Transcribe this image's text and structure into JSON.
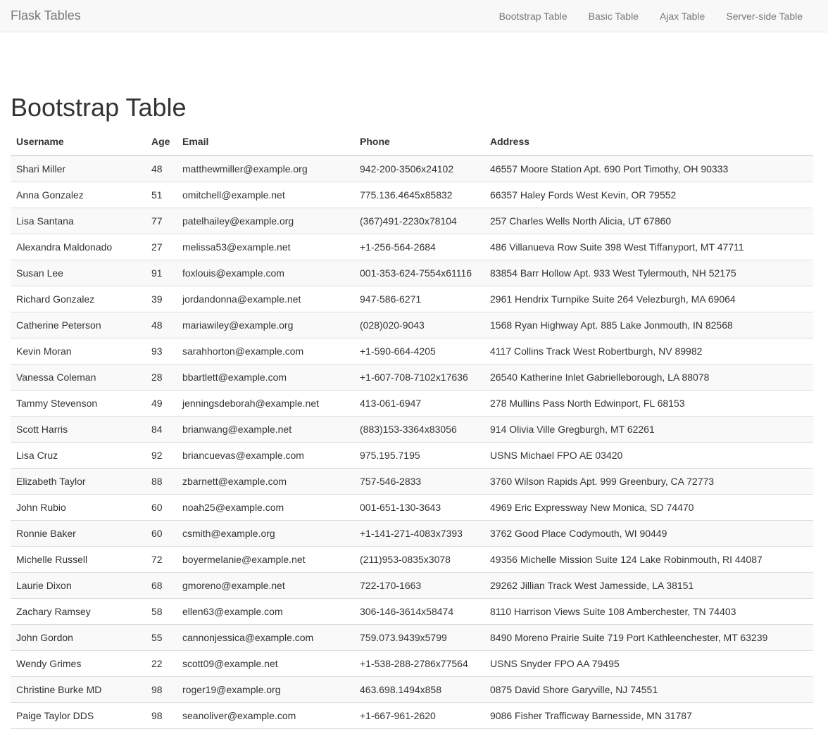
{
  "navbar": {
    "brand": "Flask Tables",
    "links": [
      "Bootstrap Table",
      "Basic Table",
      "Ajax Table",
      "Server-side Table"
    ]
  },
  "page": {
    "title": "Bootstrap Table"
  },
  "table": {
    "columns": [
      "Username",
      "Age",
      "Email",
      "Phone",
      "Address"
    ],
    "rows": [
      [
        "Shari Miller",
        "48",
        "matthewmiller@example.org",
        "942-200-3506x24102",
        "46557 Moore Station Apt. 690 Port Timothy, OH 90333"
      ],
      [
        "Anna Gonzalez",
        "51",
        "omitchell@example.net",
        "775.136.4645x85832",
        "66357 Haley Fords West Kevin, OR 79552"
      ],
      [
        "Lisa Santana",
        "77",
        "patelhailey@example.org",
        "(367)491-2230x78104",
        "257 Charles Wells North Alicia, UT 67860"
      ],
      [
        "Alexandra Maldonado",
        "27",
        "melissa53@example.net",
        "+1-256-564-2684",
        "486 Villanueva Row Suite 398 West Tiffanyport, MT 47711"
      ],
      [
        "Susan Lee",
        "91",
        "foxlouis@example.com",
        "001-353-624-7554x61116",
        "83854 Barr Hollow Apt. 933 West Tylermouth, NH 52175"
      ],
      [
        "Richard Gonzalez",
        "39",
        "jordandonna@example.net",
        "947-586-6271",
        "2961 Hendrix Turnpike Suite 264 Velezburgh, MA 69064"
      ],
      [
        "Catherine Peterson",
        "48",
        "mariawiley@example.org",
        "(028)020-9043",
        "1568 Ryan Highway Apt. 885 Lake Jonmouth, IN 82568"
      ],
      [
        "Kevin Moran",
        "93",
        "sarahhorton@example.com",
        "+1-590-664-4205",
        "4117 Collins Track West Robertburgh, NV 89982"
      ],
      [
        "Vanessa Coleman",
        "28",
        "bbartlett@example.com",
        "+1-607-708-7102x17636",
        "26540 Katherine Inlet Gabrielleborough, LA 88078"
      ],
      [
        "Tammy Stevenson",
        "49",
        "jenningsdeborah@example.net",
        "413-061-6947",
        "278 Mullins Pass North Edwinport, FL 68153"
      ],
      [
        "Scott Harris",
        "84",
        "brianwang@example.net",
        "(883)153-3364x83056",
        "914 Olivia Ville Gregburgh, MT 62261"
      ],
      [
        "Lisa Cruz",
        "92",
        "briancuevas@example.com",
        "975.195.7195",
        "USNS Michael FPO AE 03420"
      ],
      [
        "Elizabeth Taylor",
        "88",
        "zbarnett@example.com",
        "757-546-2833",
        "3760 Wilson Rapids Apt. 999 Greenbury, CA 72773"
      ],
      [
        "John Rubio",
        "60",
        "noah25@example.com",
        "001-651-130-3643",
        "4969 Eric Expressway New Monica, SD 74470"
      ],
      [
        "Ronnie Baker",
        "60",
        "csmith@example.org",
        "+1-141-271-4083x7393",
        "3762 Good Place Codymouth, WI 90449"
      ],
      [
        "Michelle Russell",
        "72",
        "boyermelanie@example.net",
        "(211)953-0835x3078",
        "49356 Michelle Mission Suite 124 Lake Robinmouth, RI 44087"
      ],
      [
        "Laurie Dixon",
        "68",
        "gmoreno@example.net",
        "722-170-1663",
        "29262 Jillian Track West Jamesside, LA 38151"
      ],
      [
        "Zachary Ramsey",
        "58",
        "ellen63@example.com",
        "306-146-3614x58474",
        "8110 Harrison Views Suite 108 Amberchester, TN 74403"
      ],
      [
        "John Gordon",
        "55",
        "cannonjessica@example.com",
        "759.073.9439x5799",
        "8490 Moreno Prairie Suite 719 Port Kathleenchester, MT 63239"
      ],
      [
        "Wendy Grimes",
        "22",
        "scott09@example.net",
        "+1-538-288-2786x77564",
        "USNS Snyder FPO AA 79495"
      ],
      [
        "Christine Burke MD",
        "98",
        "roger19@example.org",
        "463.698.1494x858",
        "0875 David Shore Garyville, NJ 74551"
      ],
      [
        "Paige Taylor DDS",
        "98",
        "seanoliver@example.com",
        "+1-667-961-2620",
        "9086 Fisher Trafficway Barnesside, MN 31787"
      ]
    ]
  }
}
